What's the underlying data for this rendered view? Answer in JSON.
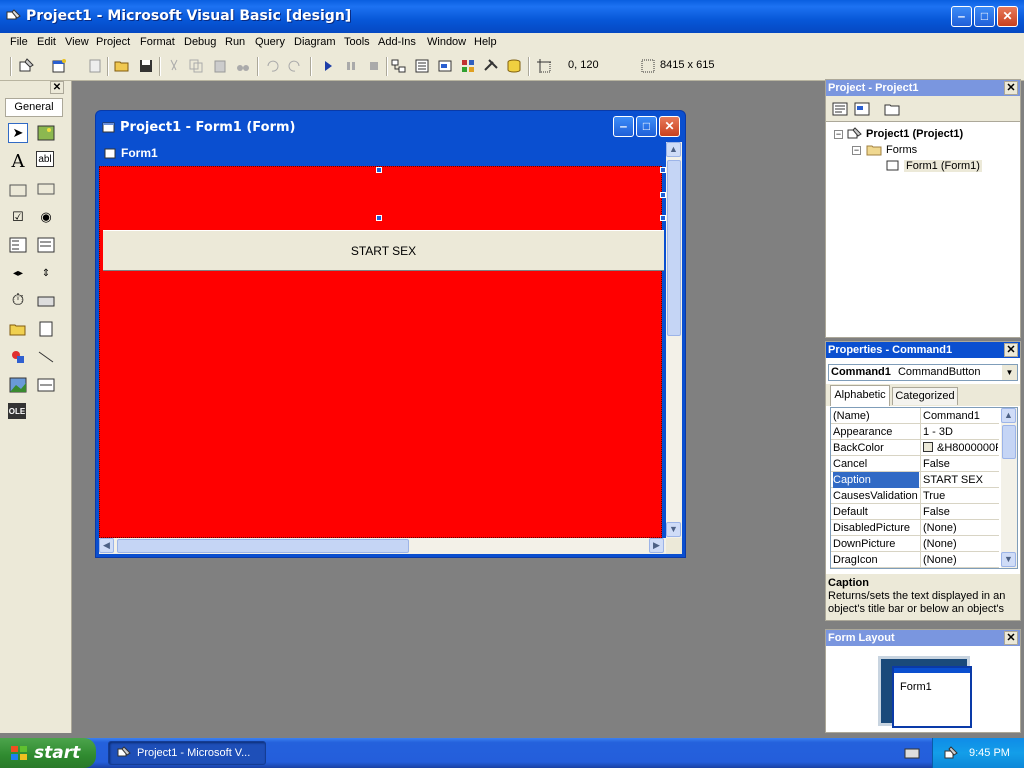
{
  "window": {
    "title": "Project1 - Microsoft Visual Basic [design]"
  },
  "menu": [
    "File",
    "Edit",
    "View",
    "Project",
    "Format",
    "Debug",
    "Run",
    "Query",
    "Diagram",
    "Tools",
    "Add-Ins",
    "Window",
    "Help"
  ],
  "toolbar": {
    "position": "0, 120",
    "size": "8415 x 615"
  },
  "toolbox": {
    "tab": "General"
  },
  "form_window": {
    "title": "Project1 - Form1 (Form)",
    "caption": "Form1",
    "button_caption": "START SEX",
    "back_color": "#ff0000"
  },
  "project_panel": {
    "title": "Project - Project1",
    "tree": [
      "Project1 (Project1)",
      "Forms",
      "Form1 (Form1)"
    ]
  },
  "properties_panel": {
    "title": "Properties - Command1",
    "object": "Command1",
    "object_type": "CommandButton",
    "tabs": [
      "Alphabetic",
      "Categorized"
    ],
    "rows": [
      {
        "name": "(Name)",
        "value": "Command1"
      },
      {
        "name": "Appearance",
        "value": "1 - 3D"
      },
      {
        "name": "BackColor",
        "value": "&H8000000F"
      },
      {
        "name": "Cancel",
        "value": "False"
      },
      {
        "name": "Caption",
        "value": "START SEX"
      },
      {
        "name": "CausesValidation",
        "value": "True"
      },
      {
        "name": "Default",
        "value": "False"
      },
      {
        "name": "DisabledPicture",
        "value": "(None)"
      },
      {
        "name": "DownPicture",
        "value": "(None)"
      },
      {
        "name": "DragIcon",
        "value": "(None)"
      }
    ],
    "selected_row": "Caption",
    "desc_title": "Caption",
    "desc_text": "Returns/sets the text displayed in an object's title bar or below an object's"
  },
  "layout_panel": {
    "title": "Form Layout",
    "form_label": "Form1"
  },
  "taskbar": {
    "start": "start",
    "item": "Project1 - Microsoft V...",
    "clock": "9:45 PM"
  }
}
